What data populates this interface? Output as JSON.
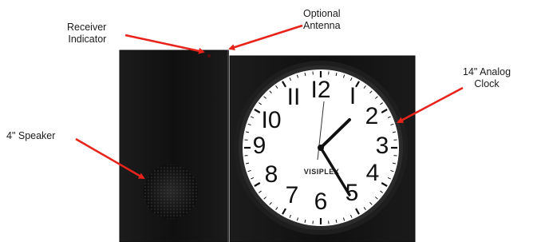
{
  "labels": {
    "receiver_line1": "Receiver",
    "receiver_line2": "Indicator",
    "antenna_line1": "Optional",
    "antenna_line2": "Antenna",
    "clock_line1": "14\" Analog",
    "clock_line2": "Clock",
    "speaker": "4\" Speaker"
  },
  "clock": {
    "brand": "VISIPLEX",
    "numerals": [
      "I2",
      "I",
      "2",
      "3",
      "4",
      "5",
      "6",
      "7",
      "8",
      "9",
      "I0",
      "II"
    ],
    "time_shown": "1:24"
  },
  "colors": {
    "arrow": "#e8231b",
    "housing": "#141414",
    "dial": "#ffffff",
    "bezel": "#1e1e1e"
  }
}
